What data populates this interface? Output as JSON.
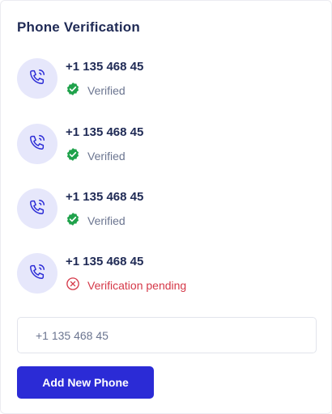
{
  "card": {
    "title": "Phone Verification"
  },
  "phones": [
    {
      "number": "+1 135 468 45",
      "status": "Verified",
      "state": "verified"
    },
    {
      "number": "+1 135 468 45",
      "status": "Verified",
      "state": "verified"
    },
    {
      "number": "+1 135 468 45",
      "status": "Verified",
      "state": "verified"
    },
    {
      "number": "+1 135 468 45",
      "status": "Verification pending",
      "state": "pending"
    }
  ],
  "new_phone": {
    "placeholder": "+1 135 468 45",
    "button_label": "Add New Phone"
  },
  "icons": {
    "avatar": "phone-call-icon",
    "verified": "check-badge-icon",
    "pending": "x-circle-icon"
  },
  "colors": {
    "accent": "#2b2bd6",
    "title": "#1f2a55",
    "avatar_bg": "#e6e7fb",
    "verified_green": "#1fa24b",
    "pending_red": "#d53848",
    "muted_text": "#6b7590"
  }
}
